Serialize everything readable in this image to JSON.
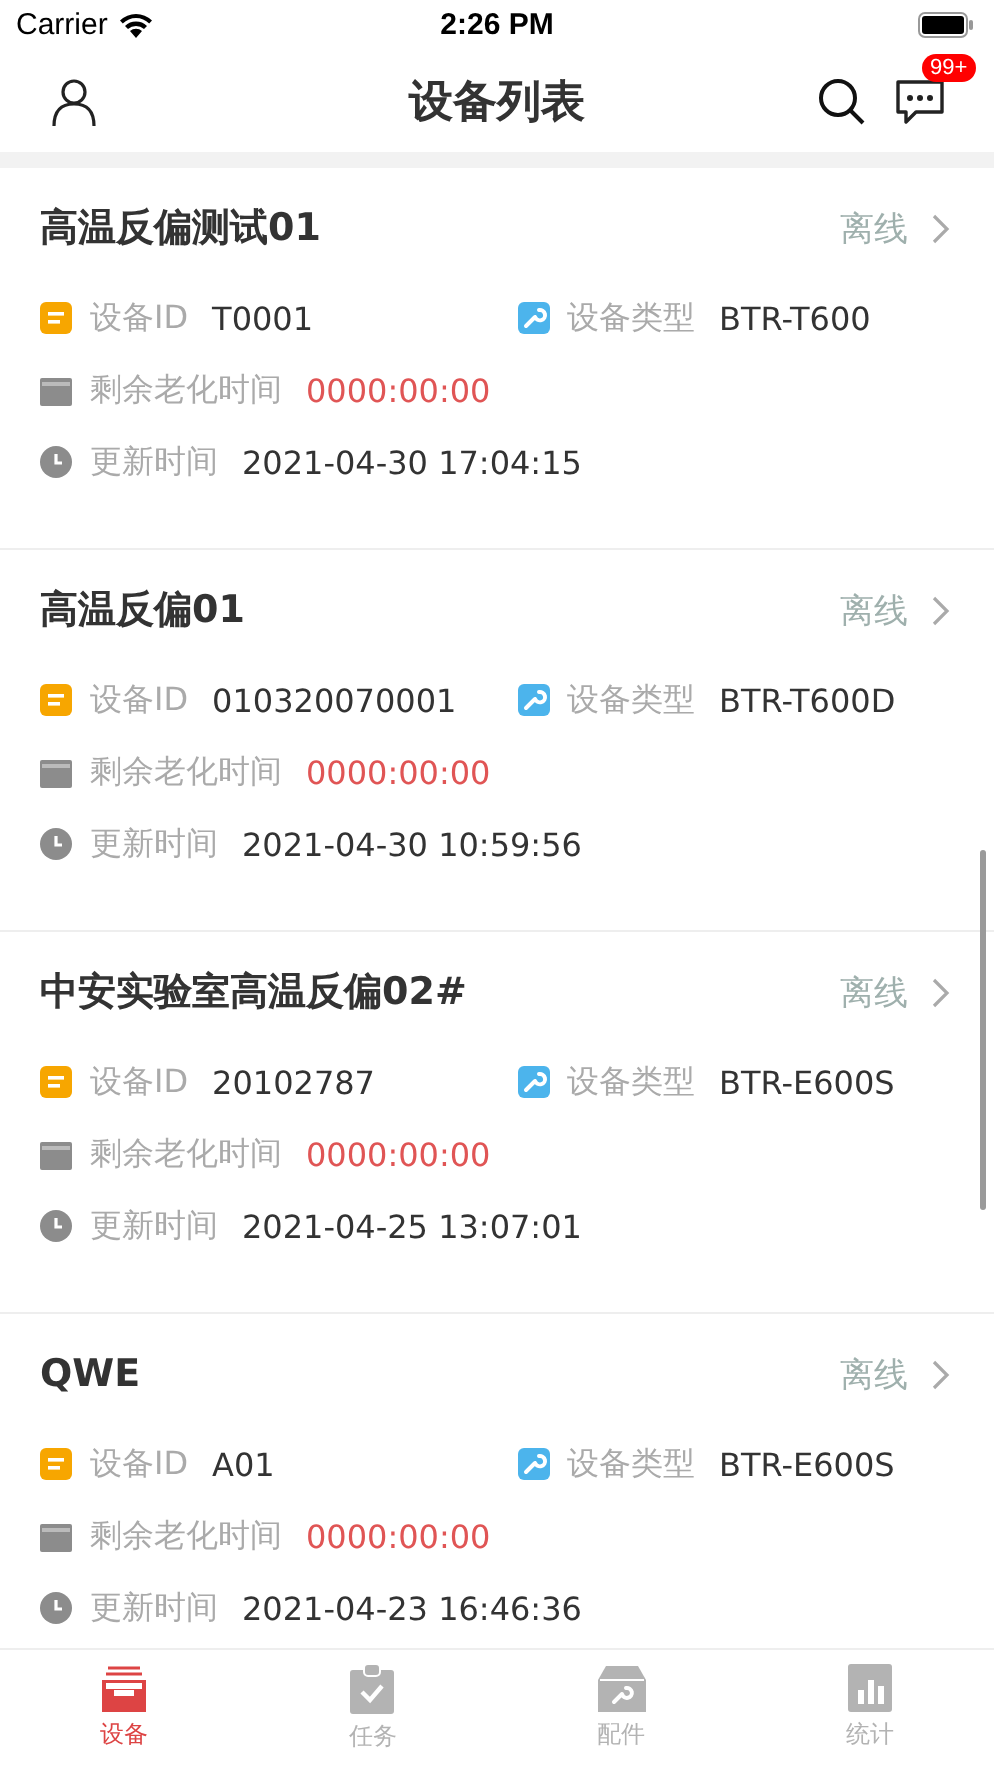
{
  "status_bar": {
    "carrier": "Carrier",
    "time": "2:26 PM"
  },
  "header": {
    "title": "设备列表",
    "badge": "99+"
  },
  "devices": [
    {
      "name": "高温反偏测试01",
      "status": "离线",
      "id_label": "设备ID",
      "id": "T0001",
      "type_label": "设备类型",
      "type": "BTR-T600",
      "remain_label": "剩余老化时间",
      "remain": "0000:00:00",
      "update_label": "更新时间",
      "update": "2021-04-30 17:04:15"
    },
    {
      "name": "高温反偏01",
      "status": "离线",
      "id_label": "设备ID",
      "id": "010320070001",
      "type_label": "设备类型",
      "type": "BTR-T600D",
      "remain_label": "剩余老化时间",
      "remain": "0000:00:00",
      "update_label": "更新时间",
      "update": "2021-04-30 10:59:56"
    },
    {
      "name": "中安实验室高温反偏02#",
      "status": "离线",
      "id_label": "设备ID",
      "id": "20102787",
      "type_label": "设备类型",
      "type": "BTR-E600S",
      "remain_label": "剩余老化时间",
      "remain": "0000:00:00",
      "update_label": "更新时间",
      "update": "2021-04-25 13:07:01"
    },
    {
      "name": "QWE",
      "status": "离线",
      "id_label": "设备ID",
      "id": "A01",
      "type_label": "设备类型",
      "type": "BTR-E600S",
      "remain_label": "剩余老化时间",
      "remain": "0000:00:00",
      "update_label": "更新时间",
      "update": "2021-04-23 16:46:36"
    }
  ],
  "tabs": [
    {
      "kind": "devices",
      "label": "设备",
      "selected": true
    },
    {
      "kind": "tasks",
      "label": "任务",
      "selected": false
    },
    {
      "kind": "parts",
      "label": "配件",
      "selected": false
    },
    {
      "kind": "stats",
      "label": "统计",
      "selected": false
    }
  ]
}
